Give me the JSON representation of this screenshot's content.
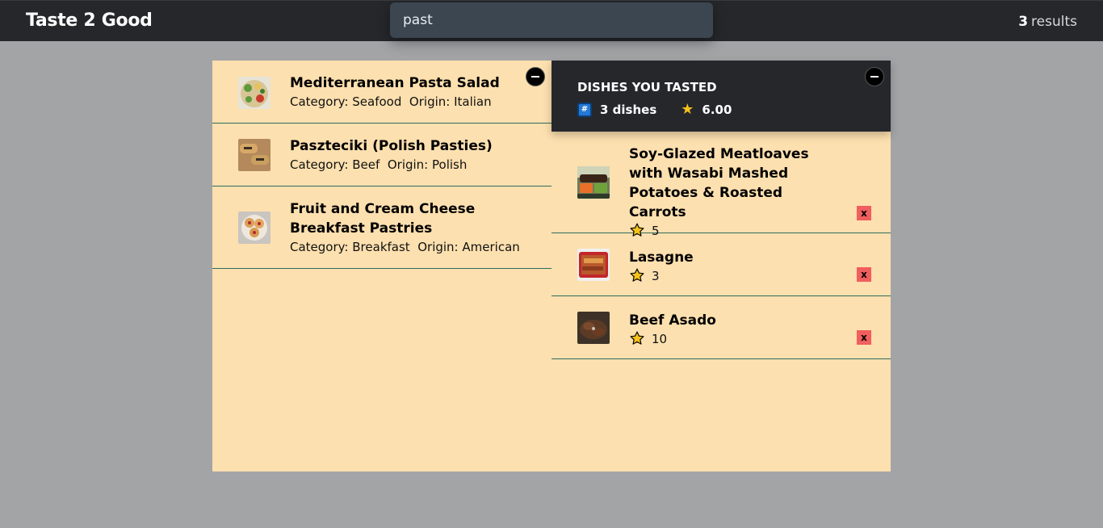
{
  "header": {
    "brand": "Taste 2 Good",
    "search_value": "past",
    "results_count": "3",
    "results_label": "results"
  },
  "search_results": [
    {
      "title": "Mediterranean Pasta Salad",
      "category_label": "Category:",
      "category": "Seafood",
      "origin_label": "Origin:",
      "origin": "Italian"
    },
    {
      "title": "Paszteciki (Polish Pasties)",
      "category_label": "Category:",
      "category": "Beef",
      "origin_label": "Origin:",
      "origin": "Polish"
    },
    {
      "title": "Fruit and Cream Cheese Breakfast Pastries",
      "category_label": "Category:",
      "category": "Breakfast",
      "origin_label": "Origin:",
      "origin": "American"
    }
  ],
  "tasted": {
    "heading": "DISHES YOU TASTED",
    "count_text": "3 dishes",
    "average_rating": "6.00",
    "items": [
      {
        "title": "Soy-Glazed Meatloaves with Wasabi Mashed Potatoes & Roasted Carrots",
        "rating": "5",
        "remove_label": "x"
      },
      {
        "title": "Lasagne",
        "rating": "3",
        "remove_label": "x"
      },
      {
        "title": "Beef Asado",
        "rating": "10",
        "remove_label": "x"
      }
    ]
  },
  "colors": {
    "panel_bg": "#fde0af",
    "header_bg": "#26272b",
    "page_bg": "#a3a4a6",
    "divider": "#2f6b5c",
    "remove_bg": "#f15e5e",
    "star": "#f6c21a"
  }
}
